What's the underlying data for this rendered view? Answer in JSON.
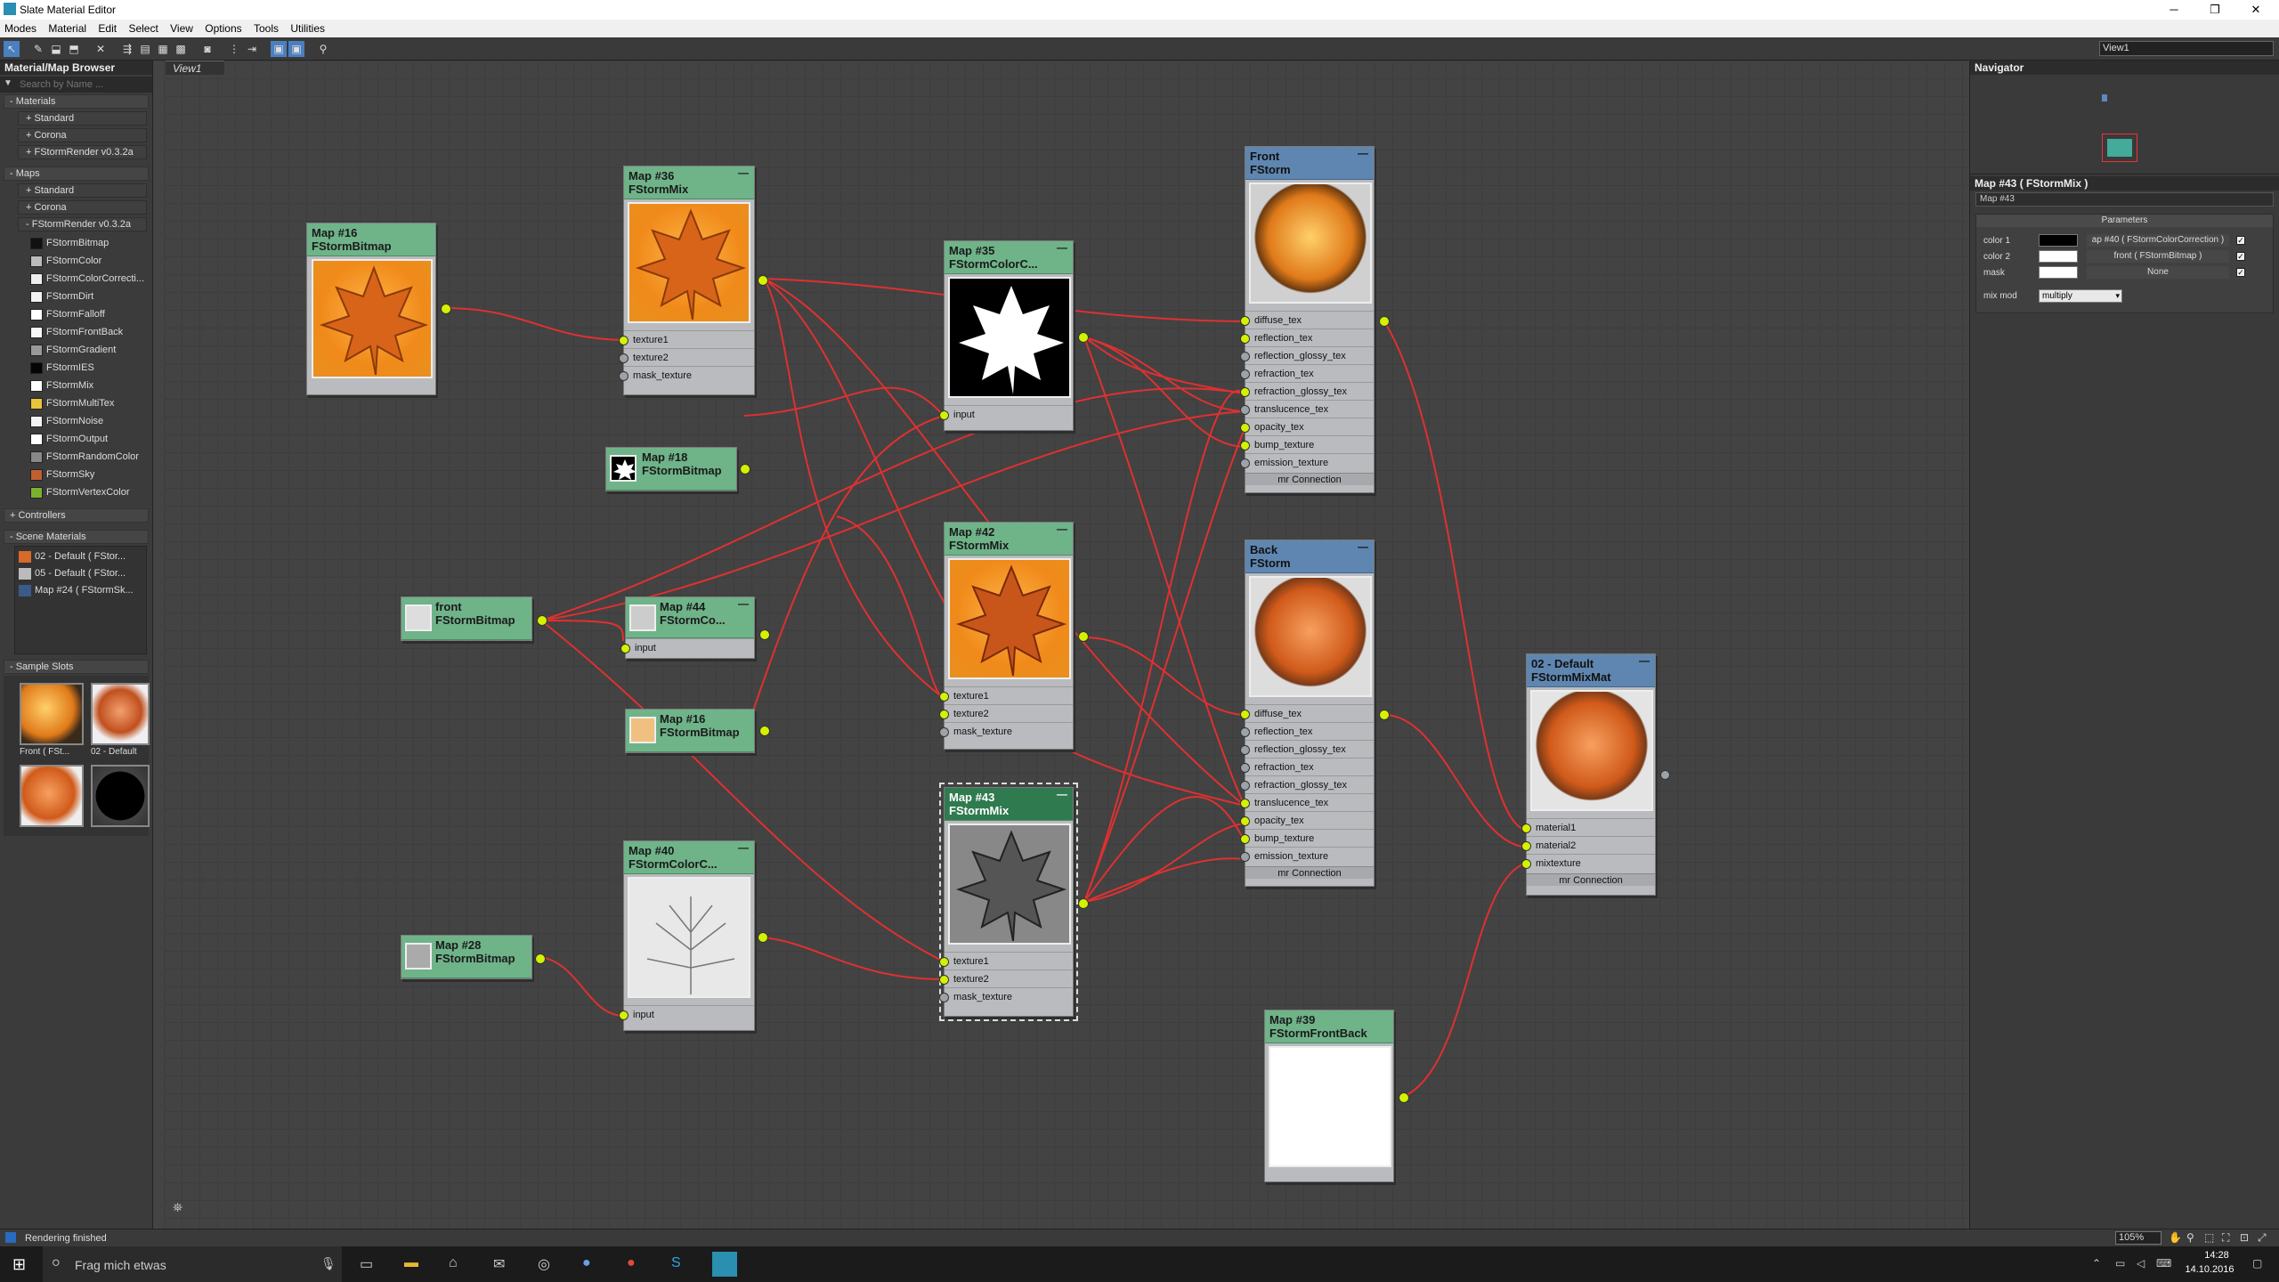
{
  "window": {
    "title": "Slate Material Editor"
  },
  "menu": [
    "Modes",
    "Material",
    "Edit",
    "Select",
    "View",
    "Options",
    "Tools",
    "Utilities"
  ],
  "view_select": "View1",
  "left_panel": {
    "title": "Material/Map Browser",
    "search_placeholder": "Search by Name ...",
    "materials_header": "- Materials",
    "materials": [
      "+ Standard",
      "+ Corona",
      "+ FStormRender v0.3.2a"
    ],
    "maps_header": "- Maps",
    "maps_groups": [
      "+ Standard",
      "+ Corona",
      "- FStormRender v0.3.2a"
    ],
    "map_items": [
      {
        "label": "FStormBitmap",
        "swatch": "#111111"
      },
      {
        "label": "FStormColor",
        "swatch": "#bbbbbb"
      },
      {
        "label": "FStormColorCorrecti...",
        "swatch": "#eeeeee"
      },
      {
        "label": "FStormDirt",
        "swatch": "#f2f2f2"
      },
      {
        "label": "FStormFalloff",
        "swatch": "#ffffff"
      },
      {
        "label": "FStormFrontBack",
        "swatch": "#f7f7f7"
      },
      {
        "label": "FStormGradient",
        "swatch": "#999999"
      },
      {
        "label": "FStormIES",
        "swatch": "#050505"
      },
      {
        "label": "FStormMix",
        "swatch": "#ffffff"
      },
      {
        "label": "FStormMultiTex",
        "swatch": "#e8c43a"
      },
      {
        "label": "FStormNoise",
        "swatch": "#f4f4f4"
      },
      {
        "label": "FStormOutput",
        "swatch": "#ffffff"
      },
      {
        "label": "FStormRandomColor",
        "swatch": "#888888"
      },
      {
        "label": "FStormSky",
        "swatch": "#c06030"
      },
      {
        "label": "FStormVertexColor",
        "swatch": "#7ab030"
      }
    ],
    "controllers_header": "+ Controllers",
    "scene_header": "- Scene Materials",
    "scene_items": [
      "02 - Default  ( FStor...",
      "05 - Default  ( FStor...",
      "Map #24  ( FStormSk..."
    ],
    "sample_header": "- Sample Slots",
    "sample_labels": [
      "Front  ( FSt...",
      "02 - Default"
    ]
  },
  "view_tab": "View1",
  "nodes": {
    "n16": {
      "title": "Map #16",
      "type": "FStormBitmap"
    },
    "n36": {
      "title": "Map #36",
      "type": "FStormMix",
      "slots": [
        "texture1",
        "texture2",
        "mask_texture"
      ]
    },
    "n35": {
      "title": "Map #35",
      "type": "FStormColorC...",
      "slots": [
        "input"
      ]
    },
    "n18": {
      "title": "Map #18",
      "type": "FStormBitmap"
    },
    "front": {
      "title": "front",
      "type": "FStormBitmap"
    },
    "n44": {
      "title": "Map #44",
      "type": "FStormCo...",
      "slots": [
        "input"
      ]
    },
    "n42": {
      "title": "Map #42",
      "type": "FStormMix",
      "slots": [
        "texture1",
        "texture2",
        "mask_texture"
      ]
    },
    "n16b": {
      "title": "Map #16",
      "type": "FStormBitmap"
    },
    "n40": {
      "title": "Map #40",
      "type": "FStormColorC...",
      "slots": [
        "input"
      ]
    },
    "n28": {
      "title": "Map #28",
      "type": "FStormBitmap"
    },
    "n43": {
      "title": "Map #43",
      "type": "FStormMix",
      "slots": [
        "texture1",
        "texture2",
        "mask_texture"
      ]
    },
    "mfront": {
      "title": "Front",
      "type": "FStorm",
      "slots": [
        "diffuse_tex",
        "reflection_tex",
        "reflection_glossy_tex",
        "refraction_tex",
        "refraction_glossy_tex",
        "translucence_tex",
        "opacity_tex",
        "bump_texture",
        "emission_texture"
      ],
      "footer": "mr Connection"
    },
    "mback": {
      "title": "Back",
      "type": "FStorm",
      "slots": [
        "diffuse_tex",
        "reflection_tex",
        "reflection_glossy_tex",
        "refraction_tex",
        "refraction_glossy_tex",
        "translucence_tex",
        "opacity_tex",
        "bump_texture",
        "emission_texture"
      ],
      "footer": "mr Connection"
    },
    "mixmat": {
      "title": "02 - Default",
      "type": "FStormMixMat",
      "slots": [
        "material1",
        "material2",
        "mixtexture"
      ],
      "footer": "mr Connection"
    },
    "n39": {
      "title": "Map #39",
      "type": "FStormFrontBack"
    }
  },
  "right_panel": {
    "navigator_title": "Navigator",
    "props_title": "Map #43  ( FStormMix )",
    "name_field": "Map #43",
    "params_title": "Parameters",
    "rows": [
      {
        "label": "color 1",
        "color": "#000000",
        "map": "ap #40  ( FStormColorCorrection )"
      },
      {
        "label": "color 2",
        "color": "#ffffff",
        "map": "front  ( FStormBitmap )"
      },
      {
        "label": "mask",
        "color": "#ffffff",
        "map": "None"
      }
    ],
    "mix_label": "mix mod",
    "mix_value": "multiply"
  },
  "status": {
    "text": "Rendering finished",
    "zoom": "105%"
  },
  "taskbar": {
    "search": "Frag mich etwas",
    "time": "14:28",
    "date": "14.10.2016"
  }
}
